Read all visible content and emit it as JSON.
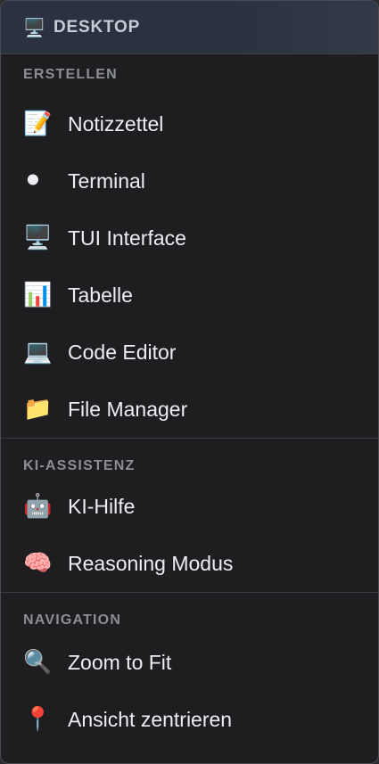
{
  "header": {
    "icon": "desktop-icon",
    "title": "DESKTOP"
  },
  "sections": [
    {
      "label": "ERSTELLEN",
      "items": [
        {
          "icon": "memo-icon",
          "glyph": "📝",
          "label": "Notizzettel"
        },
        {
          "icon": "black-circle-icon",
          "glyph": "⚫",
          "label": "Terminal"
        },
        {
          "icon": "desktop-computer-icon",
          "glyph": "🖥️",
          "label": "TUI Interface"
        },
        {
          "icon": "bar-chart-icon",
          "glyph": "📊",
          "label": "Tabelle"
        },
        {
          "icon": "laptop-icon",
          "glyph": "💻",
          "label": "Code Editor"
        },
        {
          "icon": "folder-icon",
          "glyph": "📁",
          "label": "File Manager"
        }
      ]
    },
    {
      "label": "KI-ASSISTENZ",
      "items": [
        {
          "icon": "robot-icon",
          "glyph": "🤖",
          "label": "KI-Hilfe"
        },
        {
          "icon": "brain-icon",
          "glyph": "🧠",
          "label": "Reasoning Modus"
        }
      ]
    },
    {
      "label": "NAVIGATION",
      "items": [
        {
          "icon": "magnifier-icon",
          "glyph": "🔍",
          "label": "Zoom to Fit"
        },
        {
          "icon": "pin-icon",
          "glyph": "📍",
          "label": "Ansicht zentrieren"
        }
      ]
    }
  ]
}
